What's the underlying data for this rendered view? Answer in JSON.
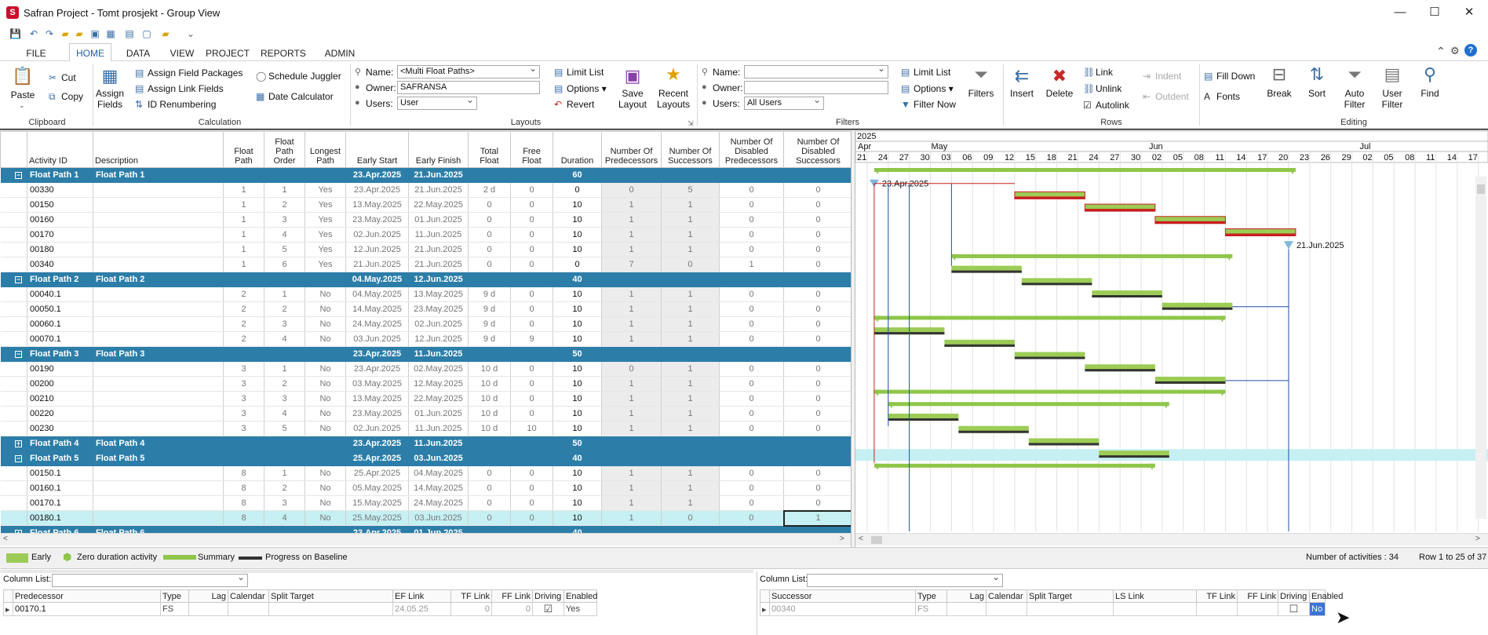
{
  "window": {
    "title": "Safran Project - Tomt prosjekt - Group View",
    "app_icon": "S",
    "minimize": "—",
    "maximize": "☐",
    "close": "✕"
  },
  "tabs": [
    "FILE",
    "HOME",
    "DATA",
    "VIEW",
    "PROJECT",
    "REPORTS",
    "ADMIN"
  ],
  "active_tab": "HOME",
  "ribbon": {
    "clipboard": {
      "paste": "Paste",
      "cut": "Cut",
      "copy": "Copy",
      "label": "Clipboard"
    },
    "calculation": {
      "assign_fields": "Assign Fields",
      "assign_field_packages": "Assign Field Packages",
      "assign_link_fields": "Assign Link Fields",
      "id_renumbering": "ID Renumbering",
      "schedule_juggler": "Schedule Juggler",
      "date_calculator": "Date Calculator",
      "label": "Calculation"
    },
    "layouts": {
      "name_label": "Name:",
      "name_value": "<Multi Float Paths>",
      "owner_label": "Owner:",
      "owner_value": "SAFRANSA",
      "users_label": "Users:",
      "users_value": "User",
      "limit_list": "Limit List",
      "options": "Options",
      "revert": "Revert",
      "save_layout": "Save Layout",
      "recent_layouts": "Recent Layouts",
      "label": "Layouts"
    },
    "filters": {
      "name_label": "Name:",
      "name_value": "",
      "owner_label": "Owner:",
      "owner_value": "",
      "users_label": "Users:",
      "users_value": "All Users",
      "limit_list": "Limit List",
      "options": "Options",
      "filter_now": "Filter Now",
      "filters": "Filters",
      "label": "Filters"
    },
    "rows": {
      "insert": "Insert",
      "delete": "Delete",
      "link": "Link",
      "unlink": "Unlink",
      "autolink": "Autolink",
      "indent": "Indent",
      "outdent": "Outdent",
      "label": "Rows"
    },
    "editing": {
      "fill_down": "Fill Down",
      "fonts": "Fonts",
      "break": "Break",
      "sort": "Sort",
      "auto_filter": "Auto Filter",
      "user_filter": "User Filter",
      "find": "Find",
      "label": "Editing"
    }
  },
  "grid": {
    "columns": [
      "Activity ID",
      "Description",
      "Float Path",
      "Float Path Order",
      "Longest Path",
      "Early Start",
      "Early Finish",
      "Total Float",
      "Free Float",
      "Duration",
      "Number Of Predecessors",
      "Number Of Successors",
      "Number Of Disabled Predecessors",
      "Number Of Disabled Successors"
    ],
    "rows": [
      {
        "g": 1,
        "toggle": "−",
        "id": "Float Path 1",
        "desc": "Float Path 1",
        "es": "23.Apr.2025",
        "ef": "21.Jun.2025",
        "dur": "60"
      },
      {
        "id": "00330",
        "fp": "1",
        "fpo": "1",
        "lp": "Yes",
        "es": "23.Apr.2025",
        "ef": "21.Jun.2025",
        "tf": "2 d",
        "ff": "0",
        "dur": "0",
        "np": "0",
        "ns": "5",
        "ndp": "0",
        "nds": "0"
      },
      {
        "id": "00150",
        "fp": "1",
        "fpo": "2",
        "lp": "Yes",
        "es": "13.May.2025",
        "ef": "22.May.2025",
        "tf": "0",
        "ff": "0",
        "dur": "10",
        "np": "1",
        "ns": "1",
        "ndp": "0",
        "nds": "0"
      },
      {
        "id": "00160",
        "fp": "1",
        "fpo": "3",
        "lp": "Yes",
        "es": "23.May.2025",
        "ef": "01.Jun.2025",
        "tf": "0",
        "ff": "0",
        "dur": "10",
        "np": "1",
        "ns": "1",
        "ndp": "0",
        "nds": "0"
      },
      {
        "id": "00170",
        "fp": "1",
        "fpo": "4",
        "lp": "Yes",
        "es": "02.Jun.2025",
        "ef": "11.Jun.2025",
        "tf": "0",
        "ff": "0",
        "dur": "10",
        "np": "1",
        "ns": "1",
        "ndp": "0",
        "nds": "0"
      },
      {
        "id": "00180",
        "fp": "1",
        "fpo": "5",
        "lp": "Yes",
        "es": "12.Jun.2025",
        "ef": "21.Jun.2025",
        "tf": "0",
        "ff": "0",
        "dur": "10",
        "np": "1",
        "ns": "1",
        "ndp": "0",
        "nds": "0"
      },
      {
        "id": "00340",
        "fp": "1",
        "fpo": "6",
        "lp": "Yes",
        "es": "21.Jun.2025",
        "ef": "21.Jun.2025",
        "tf": "0",
        "ff": "0",
        "dur": "0",
        "np": "7",
        "ns": "0",
        "ndp": "1",
        "nds": "0"
      },
      {
        "g": 1,
        "toggle": "−",
        "id": "Float Path 2",
        "desc": "Float Path 2",
        "es": "04.May.2025",
        "ef": "12.Jun.2025",
        "dur": "40"
      },
      {
        "id": "00040.1",
        "fp": "2",
        "fpo": "1",
        "lp": "No",
        "es": "04.May.2025",
        "ef": "13.May.2025",
        "tf": "9 d",
        "ff": "0",
        "dur": "10",
        "np": "1",
        "ns": "1",
        "ndp": "0",
        "nds": "0"
      },
      {
        "id": "00050.1",
        "fp": "2",
        "fpo": "2",
        "lp": "No",
        "es": "14.May.2025",
        "ef": "23.May.2025",
        "tf": "9 d",
        "ff": "0",
        "dur": "10",
        "np": "1",
        "ns": "1",
        "ndp": "0",
        "nds": "0"
      },
      {
        "id": "00060.1",
        "fp": "2",
        "fpo": "3",
        "lp": "No",
        "es": "24.May.2025",
        "ef": "02.Jun.2025",
        "tf": "9 d",
        "ff": "0",
        "dur": "10",
        "np": "1",
        "ns": "1",
        "ndp": "0",
        "nds": "0"
      },
      {
        "id": "00070.1",
        "fp": "2",
        "fpo": "4",
        "lp": "No",
        "es": "03.Jun.2025",
        "ef": "12.Jun.2025",
        "tf": "9 d",
        "ff": "9",
        "dur": "10",
        "np": "1",
        "ns": "1",
        "ndp": "0",
        "nds": "0"
      },
      {
        "g": 1,
        "toggle": "−",
        "id": "Float Path 3",
        "desc": "Float Path 3",
        "es": "23.Apr.2025",
        "ef": "11.Jun.2025",
        "dur": "50"
      },
      {
        "id": "00190",
        "fp": "3",
        "fpo": "1",
        "lp": "No",
        "es": "23.Apr.2025",
        "ef": "02.May.2025",
        "tf": "10 d",
        "ff": "0",
        "dur": "10",
        "np": "0",
        "ns": "1",
        "ndp": "0",
        "nds": "0"
      },
      {
        "id": "00200",
        "fp": "3",
        "fpo": "2",
        "lp": "No",
        "es": "03.May.2025",
        "ef": "12.May.2025",
        "tf": "10 d",
        "ff": "0",
        "dur": "10",
        "np": "1",
        "ns": "1",
        "ndp": "0",
        "nds": "0"
      },
      {
        "id": "00210",
        "fp": "3",
        "fpo": "3",
        "lp": "No",
        "es": "13.May.2025",
        "ef": "22.May.2025",
        "tf": "10 d",
        "ff": "0",
        "dur": "10",
        "np": "1",
        "ns": "1",
        "ndp": "0",
        "nds": "0"
      },
      {
        "id": "00220",
        "fp": "3",
        "fpo": "4",
        "lp": "No",
        "es": "23.May.2025",
        "ef": "01.Jun.2025",
        "tf": "10 d",
        "ff": "0",
        "dur": "10",
        "np": "1",
        "ns": "1",
        "ndp": "0",
        "nds": "0"
      },
      {
        "id": "00230",
        "fp": "3",
        "fpo": "5",
        "lp": "No",
        "es": "02.Jun.2025",
        "ef": "11.Jun.2025",
        "tf": "10 d",
        "ff": "10",
        "dur": "10",
        "np": "1",
        "ns": "1",
        "ndp": "0",
        "nds": "0"
      },
      {
        "g": 1,
        "toggle": "+",
        "id": "Float Path 4",
        "desc": "Float Path 4",
        "es": "23.Apr.2025",
        "ef": "11.Jun.2025",
        "dur": "50"
      },
      {
        "g": 1,
        "toggle": "−",
        "id": "Float Path 5",
        "desc": "Float Path 5",
        "es": "25.Apr.2025",
        "ef": "03.Jun.2025",
        "dur": "40"
      },
      {
        "id": "00150.1",
        "fp": "8",
        "fpo": "1",
        "lp": "No",
        "es": "25.Apr.2025",
        "ef": "04.May.2025",
        "tf": "0",
        "ff": "0",
        "dur": "10",
        "np": "1",
        "ns": "1",
        "ndp": "0",
        "nds": "0"
      },
      {
        "id": "00160.1",
        "fp": "8",
        "fpo": "2",
        "lp": "No",
        "es": "05.May.2025",
        "ef": "14.May.2025",
        "tf": "0",
        "ff": "0",
        "dur": "10",
        "np": "1",
        "ns": "1",
        "ndp": "0",
        "nds": "0"
      },
      {
        "id": "00170.1",
        "fp": "8",
        "fpo": "3",
        "lp": "No",
        "es": "15.May.2025",
        "ef": "24.May.2025",
        "tf": "0",
        "ff": "0",
        "dur": "10",
        "np": "1",
        "ns": "1",
        "ndp": "0",
        "nds": "0"
      },
      {
        "sel": 1,
        "id": "00180.1",
        "fp": "8",
        "fpo": "4",
        "lp": "No",
        "es": "25.May.2025",
        "ef": "03.Jun.2025",
        "tf": "0",
        "ff": "0",
        "dur": "10",
        "np": "1",
        "ns": "0",
        "ndp": "0",
        "nds": "1"
      },
      {
        "g": 1,
        "toggle": "+",
        "id": "Float Path 6",
        "desc": "Float Path 6",
        "es": "23.Apr.2025",
        "ef": "01.Jun.2025",
        "dur": "40"
      }
    ]
  },
  "gantt": {
    "year": "2025",
    "months": [
      "Apr",
      "May",
      "Jun",
      "Jul"
    ],
    "days": [
      "21",
      "24",
      "27",
      "30",
      "03",
      "06",
      "09",
      "12",
      "15",
      "18",
      "21",
      "24",
      "27",
      "30",
      "02",
      "05",
      "08",
      "11",
      "14",
      "17",
      "20",
      "23",
      "26",
      "29",
      "02",
      "05",
      "08",
      "11",
      "14",
      "17"
    ],
    "start_label": "23.Apr.2025",
    "end_label": "21.Jun.2025",
    "colors": {
      "early": "#9ccc55",
      "baseline": "#333333",
      "critical": "#c81e1e",
      "link": "#1f4ea8",
      "summary": "#8fc64a"
    }
  },
  "legend": {
    "early": "Early",
    "zero": "Zero duration activity",
    "summary": "Summary",
    "baseline": "Progress on Baseline",
    "count": "Number of activities : 34",
    "range": "Row 1 to 25 of 37"
  },
  "pred": {
    "column_list_label": "Column List:",
    "columns": [
      "Predecessor",
      "Type",
      "Lag",
      "Calendar",
      "Split Target",
      "EF Link",
      "TF Link",
      "FF Link",
      "Driving",
      "Enabled"
    ],
    "row": {
      "predecessor": "00170.1",
      "type": "FS",
      "lag": "",
      "calendar": "",
      "split_target": "",
      "ef_link": "24.05.25",
      "tf_link": "0",
      "ff_link": "0",
      "driving": "☑",
      "enabled": "Yes"
    }
  },
  "succ": {
    "column_list_label": "Column List:",
    "columns": [
      "Successor",
      "Type",
      "Lag",
      "Calendar",
      "Split Target",
      "LS Link",
      "TF Link",
      "FF Link",
      "Driving",
      "Enabled"
    ],
    "row": {
      "successor": "00340",
      "type": "FS",
      "lag": "",
      "calendar": "",
      "split_target": "",
      "ls_link": "",
      "tf_link": "",
      "ff_link": "",
      "driving": "☐",
      "enabled": "No"
    }
  }
}
